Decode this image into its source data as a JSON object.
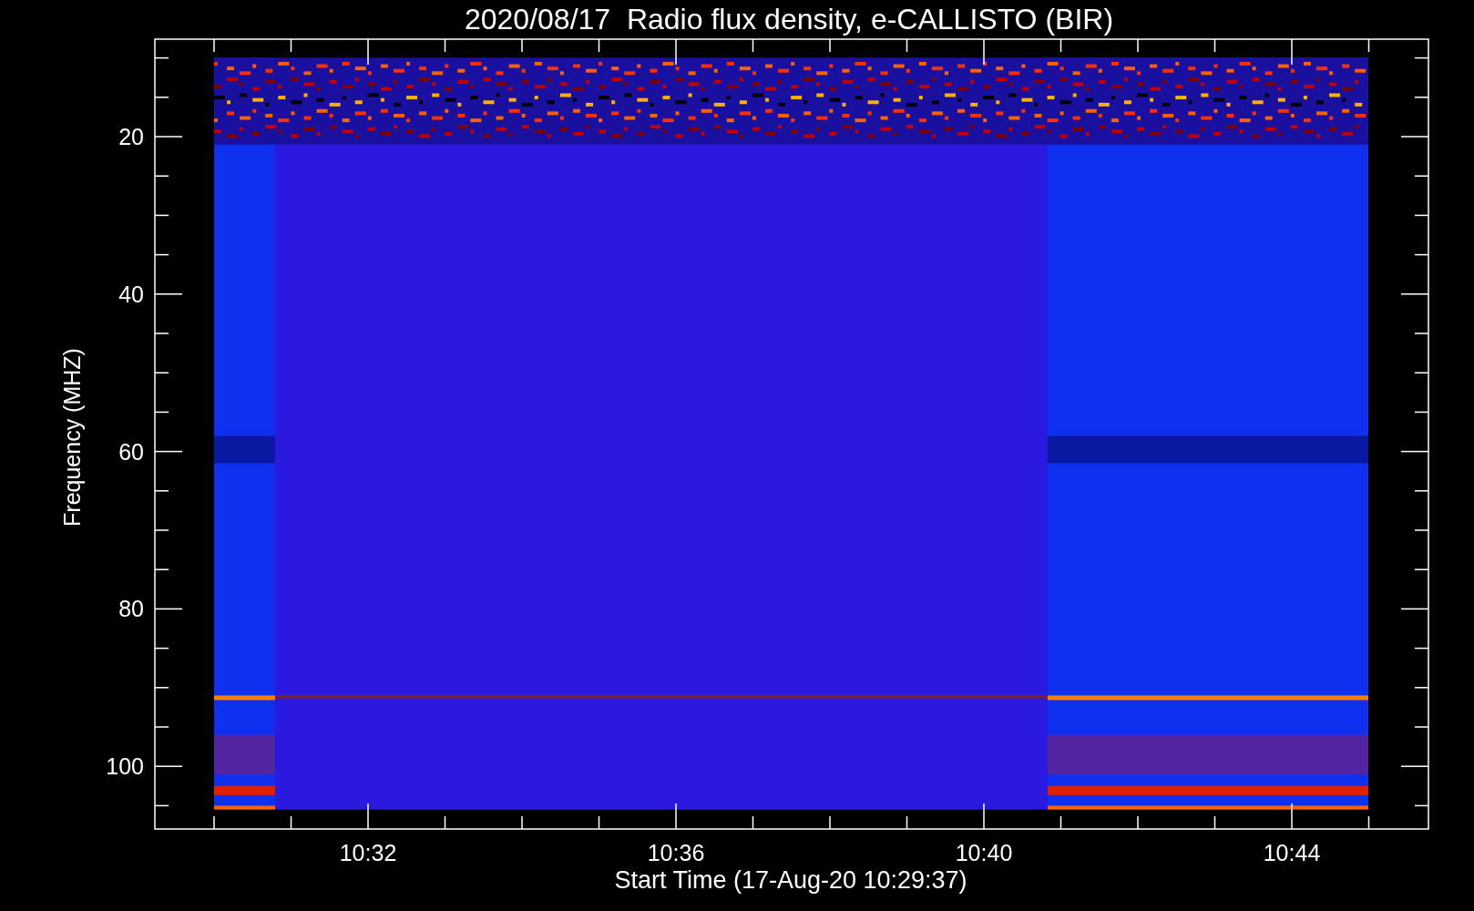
{
  "title": "2020/08/17  Radio flux density, e-CALLISTO (BIR)",
  "ylabel": "Frequency (MHZ)",
  "xlabel": "Start Time (17-Aug-20 10:29:37)",
  "yticks": [
    "20",
    "40",
    "60",
    "80",
    "100"
  ],
  "xticks": [
    "10:32",
    "10:36",
    "10:40",
    "10:44"
  ]
}
